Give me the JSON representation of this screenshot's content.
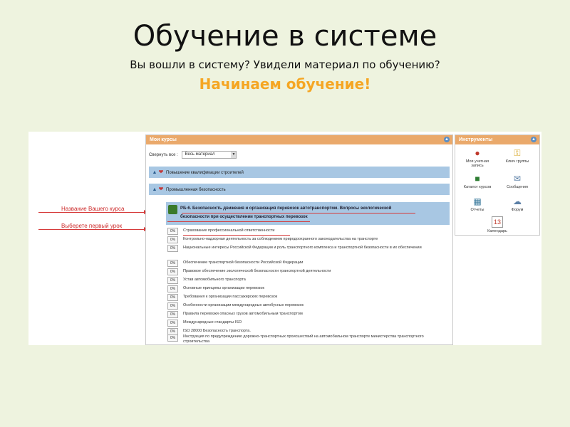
{
  "slide": {
    "title": "Обучение в системе",
    "subtitle": "Вы вошли в систему? Увидели материал по обучению?",
    "cta": "Начинаем обучение!"
  },
  "annotations": {
    "course_name": "Название Вашего курса",
    "first_lesson": "Выберете первый урок"
  },
  "colors": {
    "accent_orange": "#f5a623",
    "header_orange": "#eaa96b",
    "row_blue": "#a8c7e3",
    "arrow_red": "#d63a3a",
    "background": "#eef3df"
  },
  "my_courses": {
    "title": "Мои курсы",
    "collapse_label": "Свернуть все :",
    "collapse_selected": "Весь материал",
    "categories": [
      {
        "label": "Повышение квалификации строителей",
        "icon": "hearts-icon"
      },
      {
        "label": "Промышленная безопасность",
        "icon": "hearts-icon"
      }
    ],
    "course": {
      "line1": "РБ-6. Безопасность движения и организация перевозок автотранспортом. Вопросы экологической",
      "line2": "безопасности при осуществлении транспортных перевозок"
    },
    "lessons": [
      {
        "pct": "0%",
        "text": "Страхование профессиональной ответственности"
      },
      {
        "pct": "0%",
        "text": "Контрольно-надзорная деятельность за соблюдением природоохранного законодательства на транспорте"
      },
      {
        "pct": "0%",
        "text": "Национальные интересы Российской Федерации и роль транспортного комплекса и транспортной безопасности в их обеспечении"
      },
      {
        "pct": "0%",
        "text": "Обеспечение транспортной безопасности Российской Федерации"
      },
      {
        "pct": "0%",
        "text": "Правовое обеспечение экологической безопасности транспортной деятельности"
      },
      {
        "pct": "0%",
        "text": "Устав автомобильного транспорта"
      },
      {
        "pct": "0%",
        "text": "Основные принципы организации перевозок"
      },
      {
        "pct": "0%",
        "text": "Требования к организации пассажирских перевозок"
      },
      {
        "pct": "0%",
        "text": "Особенности организации международных автобусных перевозок"
      },
      {
        "pct": "0%",
        "text": "Правила перевозки опасных грузов автомобильным транспортом"
      },
      {
        "pct": "0%",
        "text": "Международные стандарты ISO"
      },
      {
        "pct": "0%",
        "text": "ISO 28000 Безопасность транспорта."
      },
      {
        "pct": "0%",
        "text": "Инструкция по предупреждению дорожно-транспортных происшествий на автомобильном транспорте министерства транспортного строительства"
      }
    ]
  },
  "tools": {
    "title": "Инструменты",
    "items": [
      {
        "label": "Моя учетная запись",
        "icon": "user-account-icon"
      },
      {
        "label": "Ключ группы",
        "icon": "key-icon"
      },
      {
        "label": "Каталог курсов",
        "icon": "course-catalog-icon"
      },
      {
        "label": "Сообщения",
        "icon": "messages-icon"
      },
      {
        "label": "Отчеты",
        "icon": "reports-icon"
      },
      {
        "label": "Форум",
        "icon": "forum-icon"
      },
      {
        "label": "Календарь",
        "icon": "calendar-icon"
      }
    ]
  }
}
